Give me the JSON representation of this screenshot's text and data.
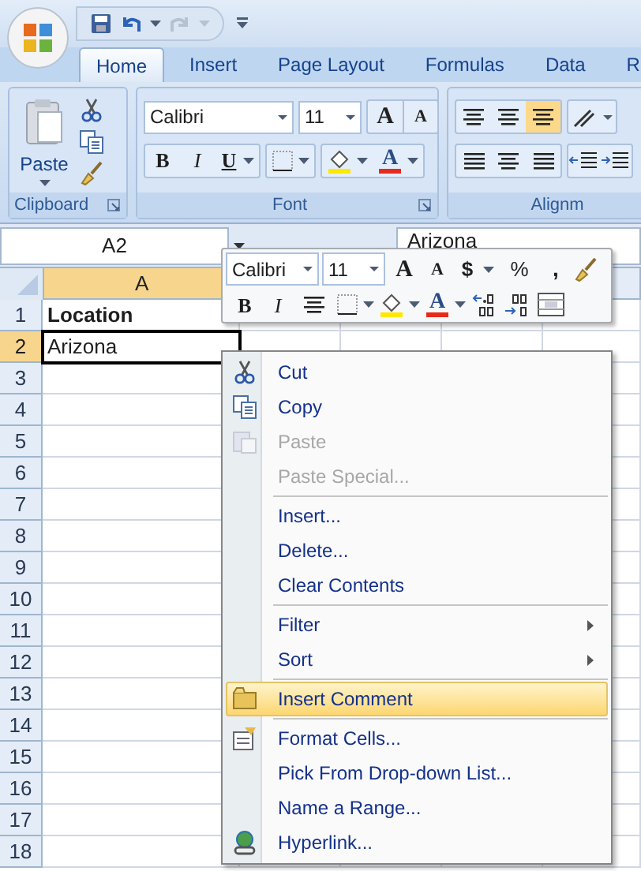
{
  "tabs": [
    {
      "label": "Home",
      "selected": true
    },
    {
      "label": "Insert",
      "selected": false
    },
    {
      "label": "Page Layout",
      "selected": false
    },
    {
      "label": "Formulas",
      "selected": false
    },
    {
      "label": "Data",
      "selected": false
    },
    {
      "label": "R",
      "selected": false
    }
  ],
  "ribbon": {
    "clipboard": {
      "label": "Clipboard",
      "paste": "Paste"
    },
    "font": {
      "label": "Font",
      "font_name": "Calibri",
      "font_size": "11",
      "grow": "A",
      "shrink": "A",
      "bold": "B",
      "italic": "I",
      "underline": "U",
      "font_color": "A"
    },
    "alignment": {
      "label": "Alignm"
    }
  },
  "name_box": "A2",
  "formula": "Arizona",
  "columns": [
    {
      "label": "A",
      "active": true
    }
  ],
  "rows": [
    {
      "number": "1",
      "cell": "Location",
      "bold": true,
      "active": false
    },
    {
      "number": "2",
      "cell": "Arizona",
      "bold": false,
      "active": true
    },
    {
      "number": "3"
    },
    {
      "number": "4"
    },
    {
      "number": "5"
    },
    {
      "number": "6"
    },
    {
      "number": "7"
    },
    {
      "number": "8"
    },
    {
      "number": "9"
    },
    {
      "number": "10"
    },
    {
      "number": "11"
    },
    {
      "number": "12"
    },
    {
      "number": "13"
    },
    {
      "number": "14"
    },
    {
      "number": "15"
    },
    {
      "number": "16"
    },
    {
      "number": "17"
    },
    {
      "number": "18"
    }
  ],
  "mini_toolbar": {
    "font_name": "Calibri",
    "font_size": "11",
    "grow": "A",
    "shrink": "A",
    "currency": "$",
    "percent": "%",
    "comma": ",",
    "bold": "B",
    "italic": "I",
    "font_color": "A"
  },
  "context_menu": [
    {
      "kind": "item",
      "label": "Cut",
      "disabled": false,
      "selected": false
    },
    {
      "kind": "item",
      "label": "Copy",
      "disabled": false,
      "selected": false
    },
    {
      "kind": "item",
      "label": "Paste",
      "disabled": true,
      "selected": false
    },
    {
      "kind": "item",
      "label": "Paste Special...",
      "disabled": true,
      "selected": false
    },
    {
      "kind": "separator"
    },
    {
      "kind": "item",
      "label": "Insert...",
      "disabled": false,
      "selected": false
    },
    {
      "kind": "item",
      "label": "Delete...",
      "disabled": false,
      "selected": false
    },
    {
      "kind": "item",
      "label": "Clear Contents",
      "disabled": false,
      "selected": false
    },
    {
      "kind": "separator"
    },
    {
      "kind": "submenu",
      "label": "Filter",
      "disabled": false,
      "selected": false
    },
    {
      "kind": "submenu",
      "label": "Sort",
      "disabled": false,
      "selected": false
    },
    {
      "kind": "separator"
    },
    {
      "kind": "item",
      "label": "Insert Comment",
      "disabled": false,
      "selected": true
    },
    {
      "kind": "separator"
    },
    {
      "kind": "item",
      "label": "Format Cells...",
      "disabled": false,
      "selected": false
    },
    {
      "kind": "item",
      "label": "Pick From Drop-down List...",
      "disabled": false,
      "selected": false
    },
    {
      "kind": "item",
      "label": "Name a Range...",
      "disabled": false,
      "selected": false
    },
    {
      "kind": "item",
      "label": "Hyperlink...",
      "disabled": false,
      "selected": false
    }
  ]
}
